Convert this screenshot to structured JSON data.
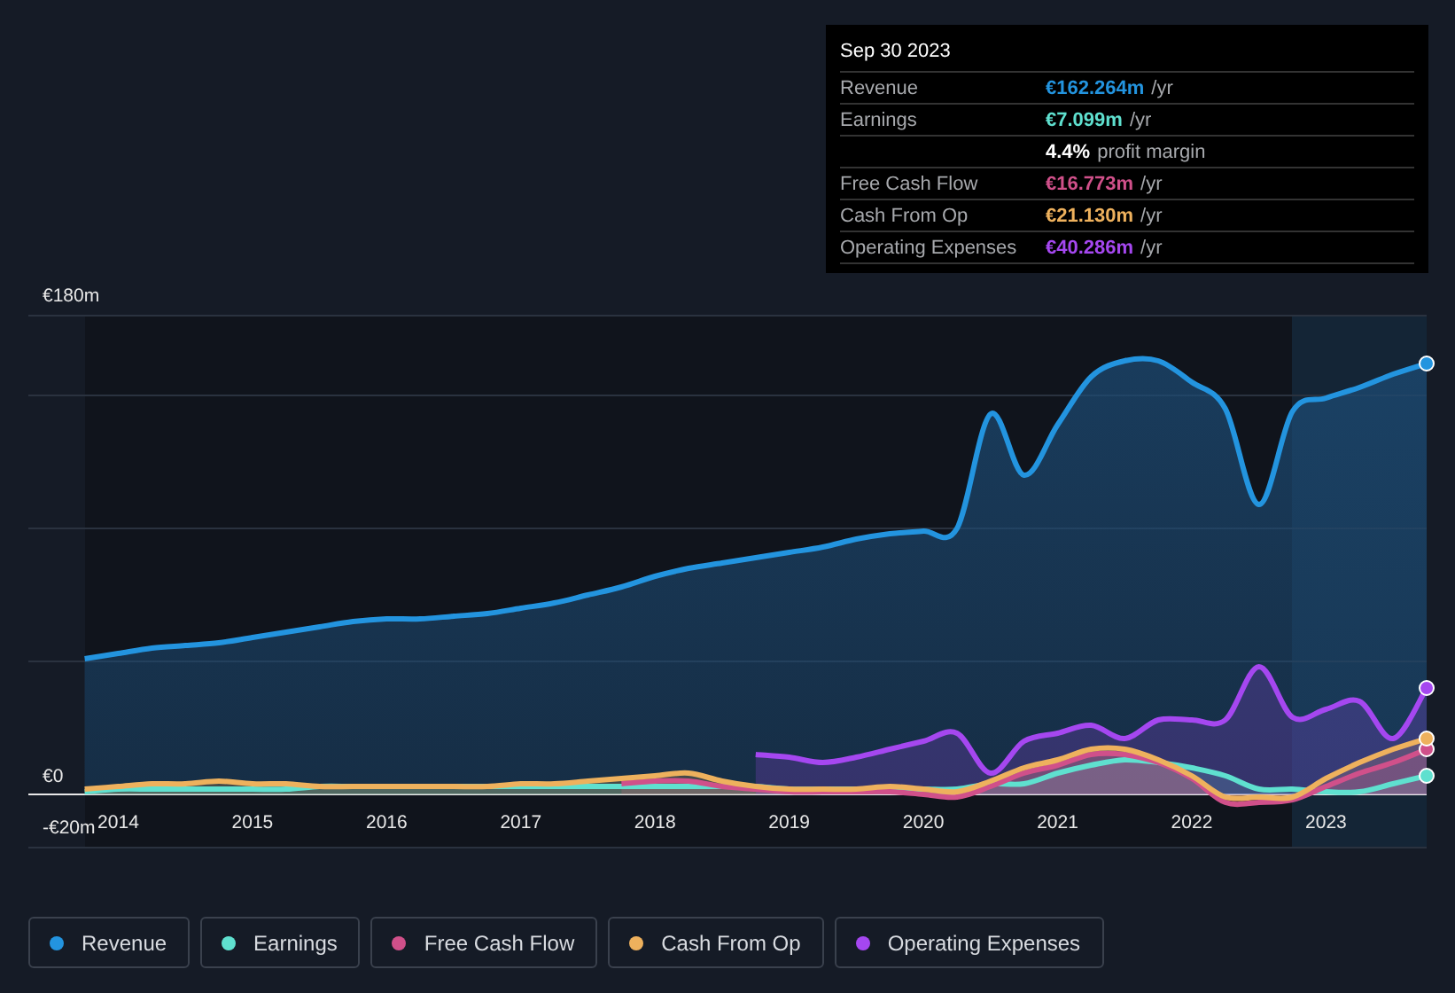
{
  "tooltip": {
    "date": "Sep 30 2023",
    "rows": [
      {
        "kind": "metric",
        "label": "Revenue",
        "value": "€162.264m",
        "unit": "/yr",
        "color": "#2394df"
      },
      {
        "kind": "metric",
        "label": "Earnings",
        "value": "€7.099m",
        "unit": "/yr",
        "color": "#5fe0cf"
      },
      {
        "kind": "margin",
        "value": "4.4%",
        "unit": "profit margin"
      },
      {
        "kind": "metric",
        "label": "Free Cash Flow",
        "value": "€16.773m",
        "unit": "/yr",
        "color": "#d0508a"
      },
      {
        "kind": "metric",
        "label": "Cash From Op",
        "value": "€21.130m",
        "unit": "/yr",
        "color": "#eeb15d"
      },
      {
        "kind": "metric",
        "label": "Operating Expenses",
        "value": "€40.286m",
        "unit": "/yr",
        "color": "#a547f0"
      }
    ]
  },
  "chart": {
    "chart_data": {
      "type": "area",
      "ylim": [
        -20,
        180
      ],
      "xlim": [
        2013.33,
        2023.75
      ],
      "yticks": [
        {
          "value": 180,
          "label": "€180m"
        },
        {
          "value": 0,
          "label": "€0"
        },
        {
          "value": -20,
          "label": "-€20m"
        }
      ],
      "xticks": [
        2014,
        2015,
        2016,
        2017,
        2018,
        2019,
        2020,
        2021,
        2022,
        2023
      ],
      "x": [
        2013.75,
        2014,
        2014.25,
        2014.5,
        2014.75,
        2015,
        2015.25,
        2015.5,
        2015.75,
        2016,
        2016.25,
        2016.5,
        2016.75,
        2017,
        2017.25,
        2017.5,
        2017.75,
        2018,
        2018.25,
        2018.5,
        2018.75,
        2019,
        2019.25,
        2019.5,
        2019.75,
        2020,
        2020.25,
        2020.5,
        2020.75,
        2021,
        2021.25,
        2021.5,
        2021.75,
        2022,
        2022.25,
        2022.5,
        2022.75,
        2023,
        2023.25,
        2023.5,
        2023.75
      ],
      "series": [
        {
          "name": "Revenue",
          "color": "#2394df",
          "values": [
            51,
            53,
            55,
            56,
            57,
            59,
            61,
            63,
            65,
            66,
            66,
            67,
            68,
            70,
            72,
            75,
            78,
            82,
            85,
            87,
            89,
            91,
            93,
            96,
            98,
            99,
            100,
            143,
            120,
            139,
            157,
            163,
            163,
            155,
            145,
            109,
            144,
            149,
            153,
            158,
            162
          ]
        },
        {
          "name": "Earnings",
          "color": "#5fe0cf",
          "values": [
            1,
            2,
            2,
            2,
            2,
            2,
            2,
            3,
            3,
            3,
            3,
            3,
            3,
            3,
            3,
            3,
            3,
            3,
            3,
            3,
            3,
            2,
            2,
            2,
            2,
            2,
            2,
            4,
            4,
            8,
            11,
            13,
            12,
            10,
            7,
            2,
            2,
            1,
            1,
            4,
            7
          ]
        },
        {
          "name": "Free Cash Flow",
          "color": "#d0508a",
          "values": [
            null,
            null,
            null,
            null,
            null,
            null,
            null,
            null,
            null,
            null,
            null,
            null,
            null,
            null,
            null,
            null,
            4,
            5,
            5,
            3,
            2,
            1,
            1,
            1,
            1,
            0,
            -1,
            3,
            8,
            11,
            15,
            15,
            12,
            6,
            -3,
            -3,
            -2,
            3,
            8,
            12,
            17
          ]
        },
        {
          "name": "Cash From Op",
          "color": "#eeb15d",
          "values": [
            2,
            3,
            4,
            4,
            5,
            4,
            4,
            3,
            3,
            3,
            3,
            3,
            3,
            4,
            4,
            5,
            6,
            7,
            8,
            5,
            3,
            2,
            2,
            2,
            3,
            2,
            1,
            5,
            10,
            13,
            17,
            17,
            13,
            7,
            -1,
            -1,
            -1,
            6,
            12,
            17,
            21
          ]
        },
        {
          "name": "Operating Expenses",
          "color": "#a547f0",
          "values": [
            null,
            null,
            null,
            null,
            null,
            null,
            null,
            null,
            null,
            null,
            null,
            null,
            null,
            null,
            null,
            null,
            null,
            null,
            null,
            null,
            15,
            14,
            12,
            14,
            17,
            20,
            23,
            8,
            20,
            23,
            26,
            21,
            28,
            28,
            28,
            48,
            29,
            32,
            35,
            21,
            40
          ]
        }
      ]
    }
  }
}
